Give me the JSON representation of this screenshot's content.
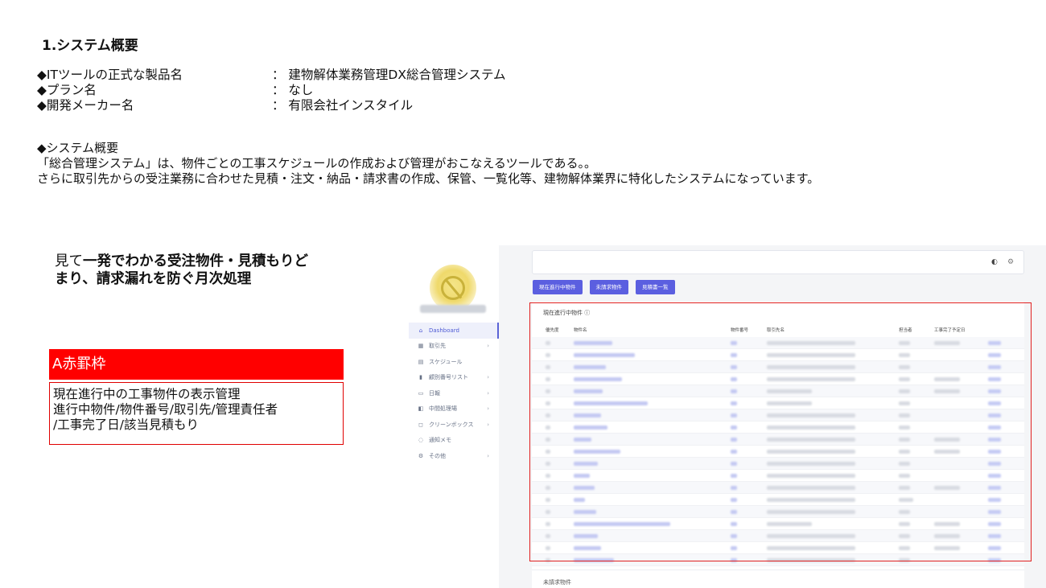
{
  "section_title": "1.システム概要",
  "info": [
    {
      "label": "◆ITツールの正式な製品名",
      "value": "： 建物解体業務管理DX総合管理システム"
    },
    {
      "label": "◆プラン名",
      "value": "： なし"
    },
    {
      "label": "◆開発メーカー名",
      "value": "： 有限会社インスタイル"
    }
  ],
  "overview": {
    "heading": "◆システム概要",
    "line1": "「総合管理システム」は、物件ごとの工事スケジュールの作成および管理がおこなえるツールである。。",
    "line2": "さらに取引先からの受注業務に合わせた見積・注文・納品・請求書の作成、保管、一覧化等、建物解体業界に特化したシステムになっています。"
  },
  "catch": {
    "light": "見て",
    "bold_1": "一発でわかる受注物件・見積もりど",
    "bold_2": "まり、請求漏れを防ぐ月次処理"
  },
  "redbox": {
    "title": "A赤罫枠",
    "line1": "現在進行中の工事物件の表示管理",
    "line2": "進行中物件/物件番号/取引先/管理責任者",
    "line3": "/工事完了日/該当見積もり"
  },
  "app": {
    "nav": [
      {
        "icon": "home-icon",
        "glyph": "⌂",
        "label": "Dashboard",
        "chevron": false
      },
      {
        "icon": "building-icon",
        "glyph": "▦",
        "label": "取引先",
        "chevron": true
      },
      {
        "icon": "calendar-icon",
        "glyph": "▤",
        "label": "スケジュール",
        "chevron": false
      },
      {
        "icon": "bar-chart-icon",
        "glyph": "▮",
        "label": "顧別番号リスト",
        "chevron": true
      },
      {
        "icon": "report-icon",
        "glyph": "▭",
        "label": "日報",
        "chevron": true
      },
      {
        "icon": "truck-icon",
        "glyph": "◧",
        "label": "中間処理場",
        "chevron": true
      },
      {
        "icon": "box-icon",
        "glyph": "◻",
        "label": "クリーンボックス",
        "chevron": true
      },
      {
        "icon": "chat-icon",
        "glyph": "◌",
        "label": "通知メモ",
        "chevron": false
      },
      {
        "icon": "gear-icon",
        "glyph": "⚙",
        "label": "その他",
        "chevron": true
      }
    ],
    "tabs": [
      "現在進行中物件",
      "未請求物件",
      "見積書一覧"
    ],
    "card_title": "現在進行中物件 ⓘ",
    "columns": [
      "優先度",
      "物件名",
      "物件番号",
      "取引先名",
      "担当者",
      "工事完了予定日"
    ],
    "row_count": 19,
    "card2_title": "未請求物件",
    "colors": {
      "accent": "#5b5fe0",
      "frame": "#e02020"
    }
  }
}
